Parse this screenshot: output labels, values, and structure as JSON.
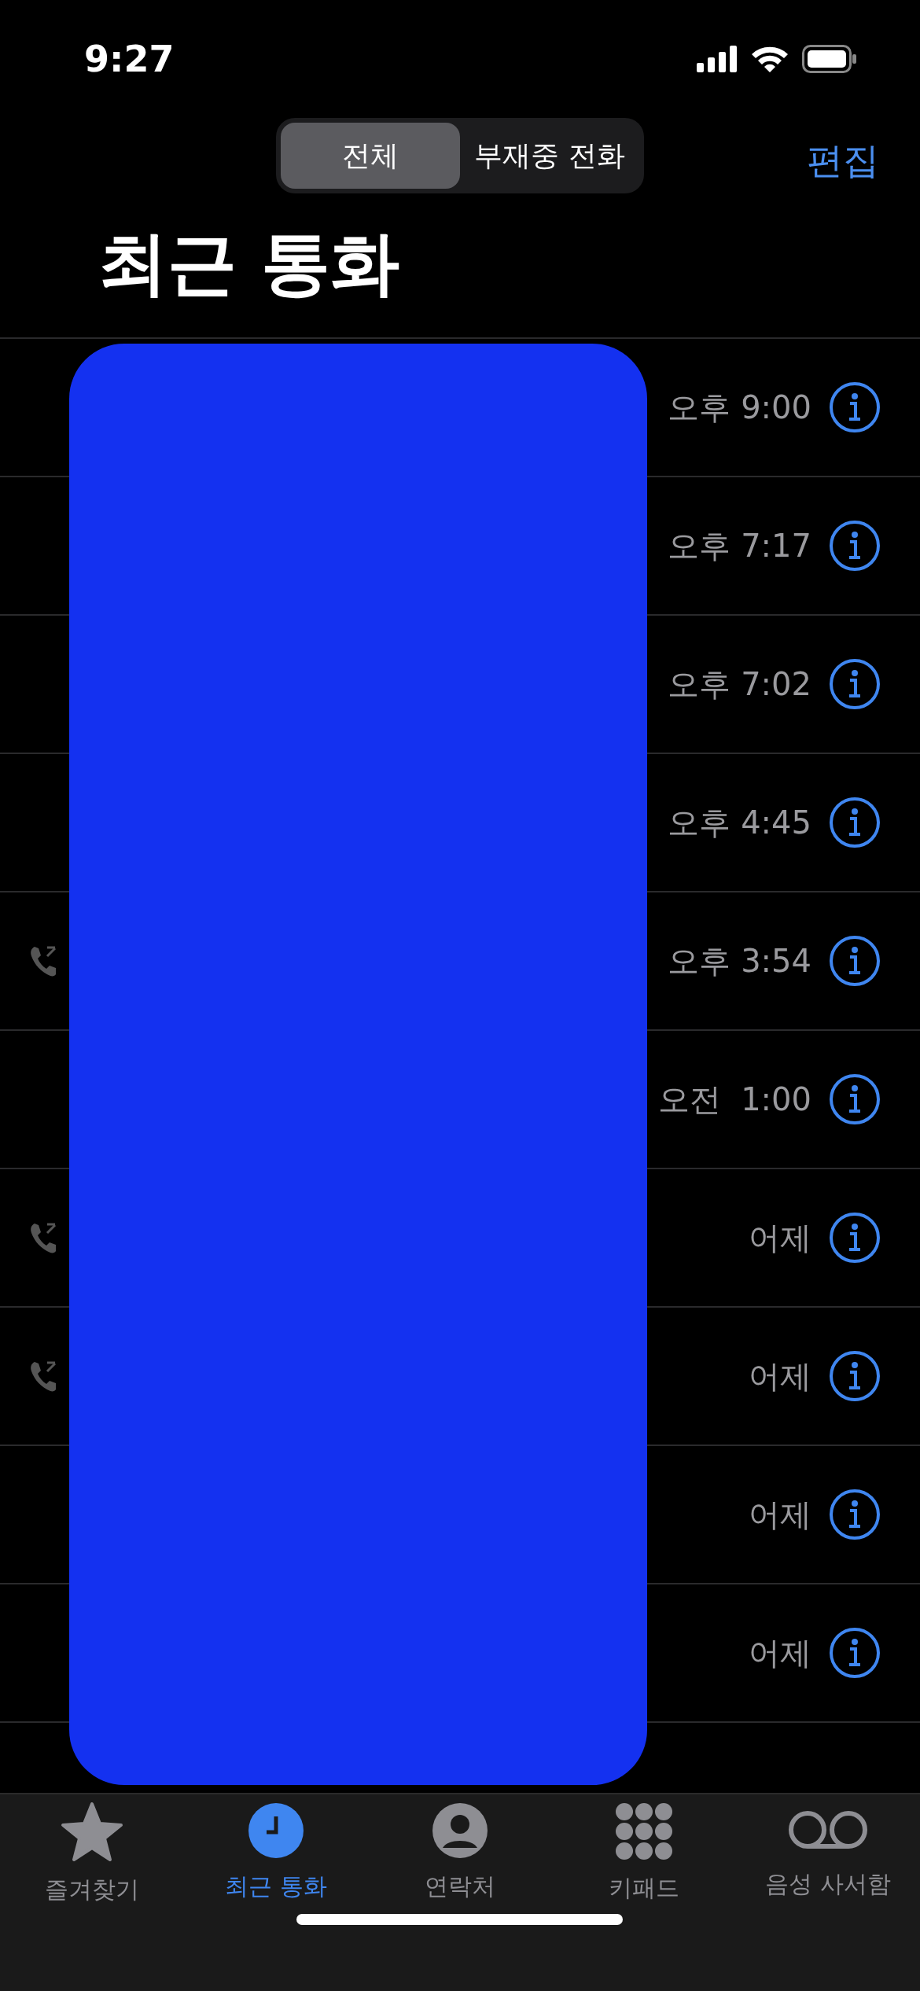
{
  "status_bar": {
    "time": "9:27"
  },
  "segments": [
    {
      "label": "전체",
      "selected": true
    },
    {
      "label": "부재중 전화",
      "selected": false
    }
  ],
  "edit_button": "편집",
  "title": "최근 통화",
  "calls": [
    {
      "time": "오후 9:00",
      "outgoing": false
    },
    {
      "time": "오후 7:17",
      "outgoing": false
    },
    {
      "time": "오후 7:02",
      "outgoing": false
    },
    {
      "time": "오후 4:45",
      "outgoing": false
    },
    {
      "time": "오후 3:54",
      "outgoing": true
    },
    {
      "time": "오전  1:00",
      "outgoing": false
    },
    {
      "time": "어제",
      "outgoing": true
    },
    {
      "time": "어제",
      "outgoing": true
    },
    {
      "time": "어제",
      "outgoing": false
    },
    {
      "time": "어제",
      "outgoing": false
    }
  ],
  "tabs": [
    {
      "label": "즐겨찾기",
      "kind": "star",
      "selected": false
    },
    {
      "label": "최근 통화",
      "kind": "clock",
      "selected": true
    },
    {
      "label": "연락처",
      "kind": "person",
      "selected": false
    },
    {
      "label": "키패드",
      "kind": "keypad",
      "selected": false
    },
    {
      "label": "음성 사서함",
      "kind": "voicemail",
      "selected": false
    }
  ]
}
